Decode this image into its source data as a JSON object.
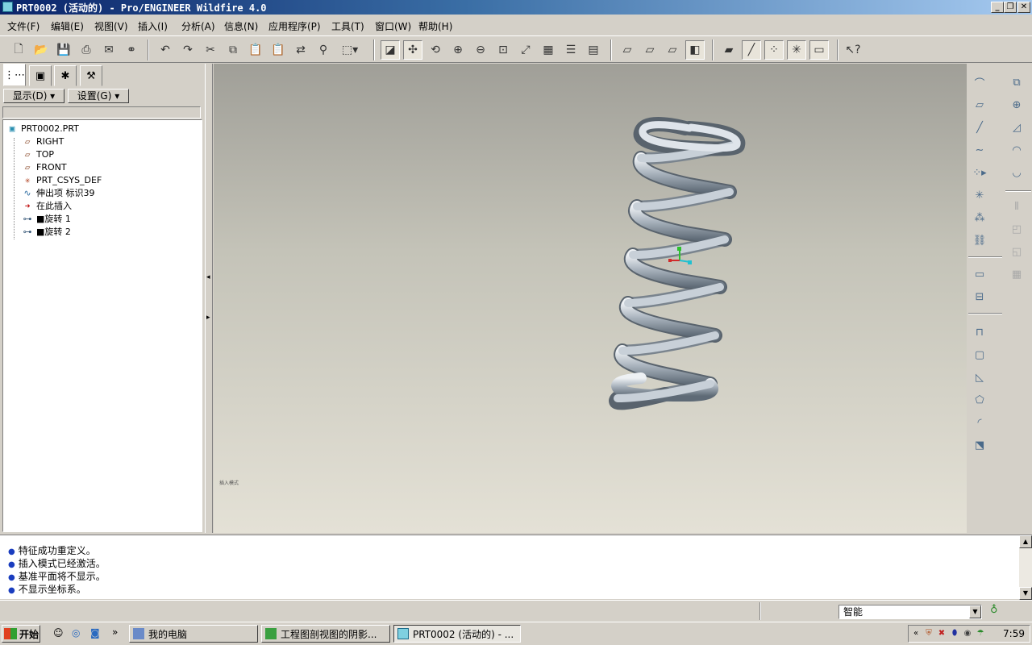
{
  "window": {
    "title": "PRT0002 (活动的) - Pro/ENGINEER Wildfire 4.0",
    "minimize": "_",
    "restore": "❐",
    "close": "✕"
  },
  "menu": [
    "文件(F)",
    "编辑(E)",
    "视图(V)",
    "插入(I)",
    "分析(A)",
    "信息(N)",
    "应用程序(P)",
    "工具(T)",
    "窗口(W)",
    "帮助(H)"
  ],
  "left_panel": {
    "show_button": "显示(D) ▾",
    "settings_button": "设置(G) ▾",
    "tree": [
      {
        "icon": "part-icon",
        "label": "PRT0002.PRT"
      },
      {
        "icon": "datum-plane-icon",
        "label": "RIGHT"
      },
      {
        "icon": "datum-plane-icon",
        "label": "TOP"
      },
      {
        "icon": "datum-plane-icon",
        "label": "FRONT"
      },
      {
        "icon": "csys-icon",
        "label": "PRT_CSYS_DEF"
      },
      {
        "icon": "extrude-icon",
        "label": "伸出项 标识39"
      },
      {
        "icon": "insert-here-arrow-icon",
        "label": "在此插入"
      },
      {
        "icon": "revolve-icon",
        "label": "■旋转 1"
      },
      {
        "icon": "revolve-icon",
        "label": "■旋转 2"
      }
    ]
  },
  "viewport": {
    "watermark": "插入模式"
  },
  "messages": [
    "特征成功重定义。",
    "插入模式已经激活。",
    "基准平面将不显示。",
    "不显示坐标系。"
  ],
  "status": {
    "filter": "智能"
  },
  "taskbar": {
    "start": "开始",
    "more": "»",
    "tasks": [
      "我的电脑",
      "工程图剖视图的阴影...",
      "PRT0002 (活动的) - ..."
    ],
    "tray_expand": "«",
    "clock": "7:59"
  }
}
